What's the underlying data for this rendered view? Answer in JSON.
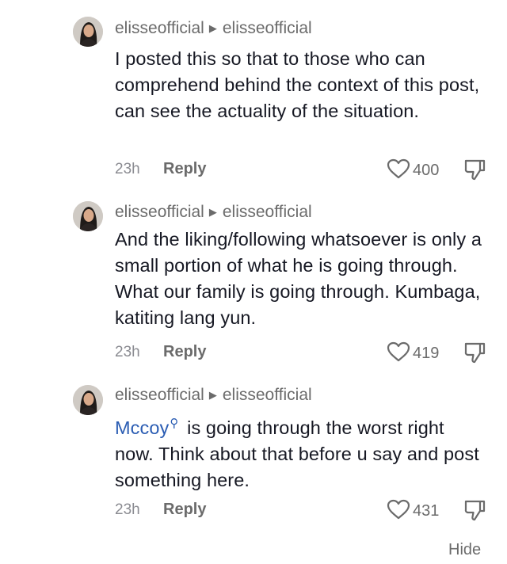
{
  "comments": [
    {
      "author": "elisseofficial",
      "reply_to": "elisseofficial",
      "text": "I posted this so that to those who can comprehend behind the context of this post, can see the actuality of the situation.",
      "time": "23h",
      "reply_label": "Reply",
      "likes": "400"
    },
    {
      "author": "elisseofficial",
      "reply_to": "elisseofficial",
      "text": "And the liking/following whatsoever is only a small portion of what he is going through. What our family is going through. Kumbaga, katiting lang yun.",
      "time": "23h",
      "reply_label": "Reply",
      "likes": "419"
    },
    {
      "author": "elisseofficial",
      "reply_to": "elisseofficial",
      "mention": "Mccoy",
      "text": " is going through the worst right now. Think about that before u say and post something here.",
      "time": "23h",
      "reply_label": "Reply",
      "likes": "431"
    }
  ],
  "hide_label": "Hide",
  "icons": {
    "reply_arrow": "play-arrow-icon",
    "like": "heart-outline-icon",
    "dislike": "thumbs-down-icon",
    "mention": "search-icon"
  },
  "colors": {
    "text": "#161823",
    "secondary": "#6b6b6b",
    "mention": "#2b5db3"
  }
}
